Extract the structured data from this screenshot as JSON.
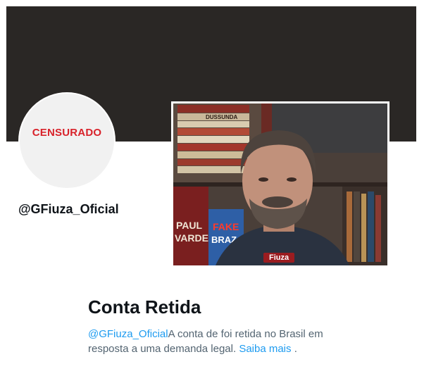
{
  "profile": {
    "avatar_label": "CENSURADO",
    "handle": "@GFiuza_Oficial"
  },
  "video": {
    "badge": "Fiuza",
    "book_spines": [
      "DUSSUNDA"
    ],
    "book_covers": [
      "FAKE",
      "BRAZ",
      "PAUL",
      "VARDE"
    ]
  },
  "withheld": {
    "title": "Conta Retida",
    "handle_link": "@GFiuza_Oficial",
    "message": "A conta de foi retida no Brasil em resposta a uma demanda legal.",
    "learn_more": "Saiba mais",
    "period": "."
  },
  "colors": {
    "banner": "#2a2725",
    "censored_red": "#d8222a",
    "link_blue": "#1d9bf0",
    "text_gray": "#536471"
  }
}
